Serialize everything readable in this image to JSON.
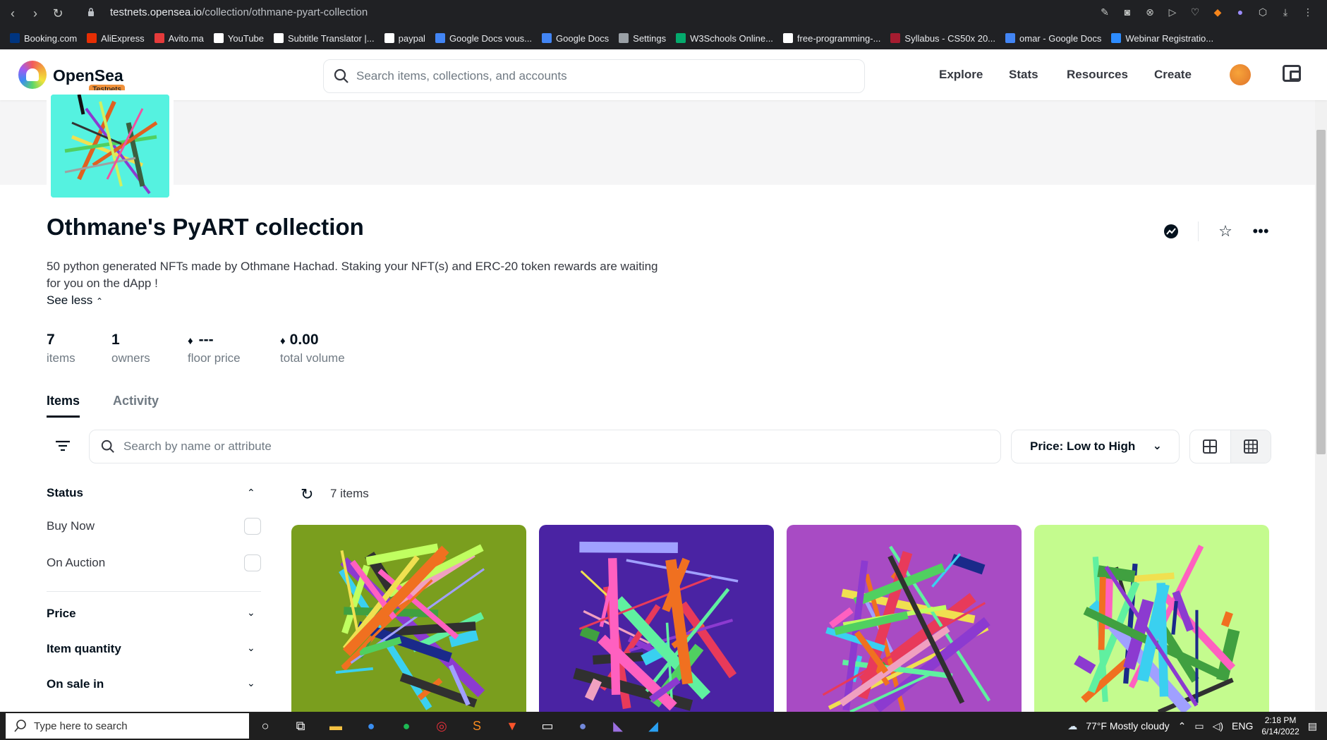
{
  "browser": {
    "url_host": "testnets.opensea.io",
    "url_path": "/collection/othmane-pyart-collection",
    "bookmarks": [
      {
        "label": "Booking.com",
        "color": "#003580"
      },
      {
        "label": "AliExpress",
        "color": "#e62e04"
      },
      {
        "label": "Avito.ma",
        "color": "#e53b3b"
      },
      {
        "label": "YouTube",
        "color": "#ffffff"
      },
      {
        "label": "Subtitle Translator |...",
        "color": "#ffffff"
      },
      {
        "label": "paypal",
        "color": "#ffffff"
      },
      {
        "label": "Google Docs vous...",
        "color": "#4285f4"
      },
      {
        "label": "Google Docs",
        "color": "#4285f4"
      },
      {
        "label": "Settings",
        "color": "#9aa0a6"
      },
      {
        "label": "W3Schools Online...",
        "color": "#04aa6d"
      },
      {
        "label": "free-programming-...",
        "color": "#ffffff"
      },
      {
        "label": "Syllabus - CS50x 20...",
        "color": "#a51c30"
      },
      {
        "label": "omar - Google Docs",
        "color": "#4285f4"
      },
      {
        "label": "Webinar Registratio...",
        "color": "#2d8cff"
      }
    ]
  },
  "header": {
    "brand": "OpenSea",
    "badge": "Testnets",
    "search_placeholder": "Search items, collections, and accounts",
    "nav": [
      "Explore",
      "Stats",
      "Resources",
      "Create"
    ]
  },
  "collection": {
    "title": "Othmane's PyART collection",
    "description": "50 python generated NFTs made by Othmane Hachad. Staking your NFT(s) and ERC-20 token rewards are waiting for you on the dApp !",
    "see_less": "See less",
    "stats": [
      {
        "value": "7",
        "label": "items"
      },
      {
        "value": "1",
        "label": "owners"
      },
      {
        "value": "---",
        "label": "floor price",
        "eth": true
      },
      {
        "value": "0.00",
        "label": "total volume",
        "eth": true
      }
    ]
  },
  "tabs": [
    "Items",
    "Activity"
  ],
  "toolbar": {
    "search_placeholder": "Search by name or attribute",
    "sort_label": "Price: Low to High"
  },
  "sidebar": {
    "status_heading": "Status",
    "status_options": [
      "Buy Now",
      "On Auction"
    ],
    "sections": [
      "Price",
      "Item quantity",
      "On sale in"
    ]
  },
  "results": {
    "count_label": "7 items"
  },
  "cards": [
    {
      "bg": "#7a9e1e"
    },
    {
      "bg": "#4a23a3"
    },
    {
      "bg": "#a84bc4"
    },
    {
      "bg": "#c4fb8e"
    }
  ],
  "taskbar": {
    "search_placeholder": "Type here to search",
    "weather": "77°F  Mostly cloudy",
    "lang": "ENG",
    "time": "2:18 PM",
    "date": "6/14/2022"
  }
}
